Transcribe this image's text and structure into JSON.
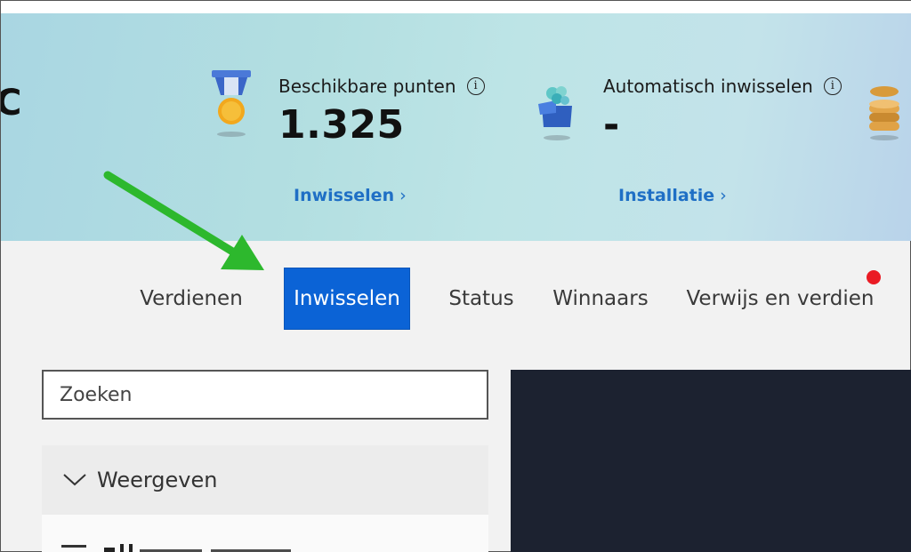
{
  "header": {
    "brand_fragment": "C",
    "points": {
      "label": "Beschikbare punten",
      "value": "1.325",
      "link": "Inwisselen",
      "icon": "medal-icon"
    },
    "auto_redeem": {
      "label": "Automatisch inwisselen",
      "value": "-",
      "link": "Installatie",
      "icon": "gift-box-icon"
    },
    "third_icon": "coins-icon",
    "info_glyph": "i",
    "chevron_glyph": "›"
  },
  "tabs": [
    {
      "label": "Verdienen",
      "active": false
    },
    {
      "label": "Inwisselen",
      "active": true
    },
    {
      "label": "Status",
      "active": false
    },
    {
      "label": "Winnaars",
      "active": false
    },
    {
      "label": "Verwijs en verdien",
      "active": false
    }
  ],
  "search": {
    "placeholder": "Zoeken"
  },
  "filter": {
    "header_label": "Weergeven"
  },
  "colors": {
    "accent": "#0b63d6",
    "link": "#1f6fc5",
    "notification": "#ea1b24",
    "annotation_arrow": "#2db82d",
    "dark_panel": "#1c2230"
  }
}
